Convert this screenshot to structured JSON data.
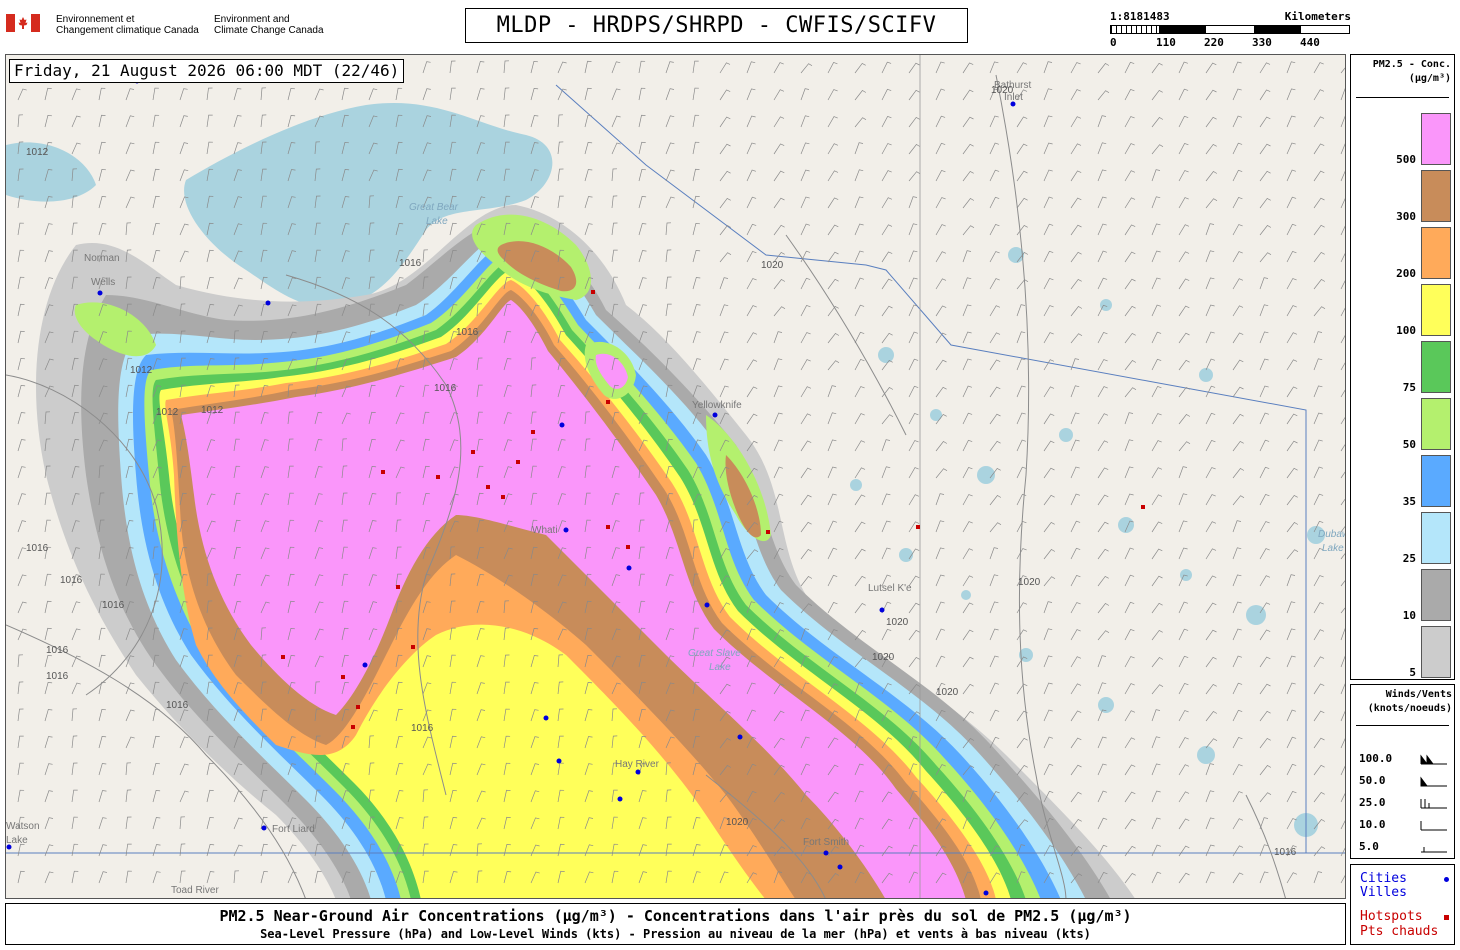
{
  "header": {
    "agency_fr_line1": "Environnement et",
    "agency_fr_line2": "Changement climatique Canada",
    "agency_en_line1": "Environment and",
    "agency_en_line2": "Climate Change Canada",
    "title": "MLDP - HRDPS/SHRPD - CWFIS/SCIFV"
  },
  "scale_bar": {
    "ratio": "1:8181483",
    "unit": "Kilometers",
    "labels": [
      "0",
      "110",
      "220",
      "330",
      "440"
    ]
  },
  "map": {
    "datetime": "Friday, 21 August 2026 06:00 MDT (22/46)",
    "places": [
      {
        "name": "Bathurst",
        "kind": "city"
      },
      {
        "name": "Inlet",
        "kind": "city"
      },
      {
        "name": "Great Bear",
        "kind": "water"
      },
      {
        "name": "Lake",
        "kind": "water"
      },
      {
        "name": "Norman",
        "kind": "city"
      },
      {
        "name": "Wells",
        "kind": "city"
      },
      {
        "name": "Yellowknife",
        "kind": "city"
      },
      {
        "name": "Whati",
        "kind": "city"
      },
      {
        "name": "Great Slave",
        "kind": "water"
      },
      {
        "name": "Lake",
        "kind": "water"
      },
      {
        "name": "Hay River",
        "kind": "city"
      },
      {
        "name": "Fort Smith",
        "kind": "city"
      },
      {
        "name": "Fort Liard",
        "kind": "city"
      },
      {
        "name": "Toad River",
        "kind": "city"
      },
      {
        "name": "Lutsel K'e",
        "kind": "city"
      },
      {
        "name": "Dubawnt",
        "kind": "water"
      },
      {
        "name": "Lake",
        "kind": "water"
      },
      {
        "name": "Watson",
        "kind": "city"
      },
      {
        "name": "Lake",
        "kind": "city"
      }
    ],
    "isobars": [
      "1012",
      "1012",
      "1012",
      "1012",
      "1016",
      "1016",
      "1016",
      "1016",
      "1016",
      "1016",
      "1016",
      "1016",
      "1016",
      "1016",
      "1020",
      "1020",
      "1020",
      "1020",
      "1020",
      "1020",
      "1020",
      "1016"
    ],
    "pm25_colors": {
      "5": "#cccccc",
      "10": "#aaaaaa",
      "25": "#b4e6fa",
      "35": "#5aaaff",
      "50": "#b4f06e",
      "75": "#5ac85a",
      "100": "#ffff5a",
      "200": "#ffaa5a",
      "300": "#c88c5a",
      "500": "#fa96fa"
    },
    "hotspot_color": "#c80000",
    "city_color": "#0000dd"
  },
  "legend": {
    "title_line1": "PM2.5 - Conc.",
    "title_line2": "(µg/m³)",
    "levels": [
      "500",
      "300",
      "200",
      "100",
      "75",
      "50",
      "35",
      "25",
      "10",
      "5"
    ],
    "colors": [
      "#fa96fa",
      "#c88c5a",
      "#ffaa5a",
      "#ffff5a",
      "#5ac85a",
      "#b4f06e",
      "#5aaaff",
      "#b4e6fa",
      "#aaaaaa",
      "#cccccc"
    ]
  },
  "wind_legend": {
    "title_line1": "Winds/Vents",
    "title_line2": "(knots/noeuds)",
    "rows": [
      "100.0",
      "50.0",
      "25.0",
      "10.0",
      "5.0"
    ]
  },
  "cities_legend": {
    "cities_en": "Cities",
    "cities_fr": "Villes",
    "hotspots_en": "Hotspots",
    "hotspots_fr": "Pts chauds"
  },
  "caption": {
    "line1": "PM2.5 Near-Ground Air Concentrations (µg/m³) - Concentrations dans l'air près du sol de PM2.5 (µg/m³)",
    "line2": "Sea-Level Pressure (hPa) and Low-Level Winds (kts) - Pression au niveau de la mer (hPa) et vents à bas niveau (kts)"
  }
}
